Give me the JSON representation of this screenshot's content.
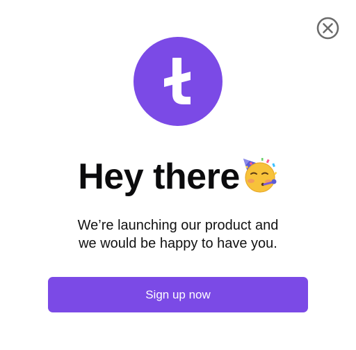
{
  "modal": {
    "close_icon": "close-circle-icon",
    "logo_icon": "brand-logo-icon",
    "title": "Hey there",
    "title_emoji": "partying-face-emoji",
    "subtitle_line1": "We’re launching our product and",
    "subtitle_line2": "we would be happy to have you.",
    "cta_label": "Sign up now"
  },
  "colors": {
    "accent": "#7b4ae6",
    "text": "#0b0b0d",
    "close_icon": "#6b6b6b",
    "background": "#ffffff"
  }
}
